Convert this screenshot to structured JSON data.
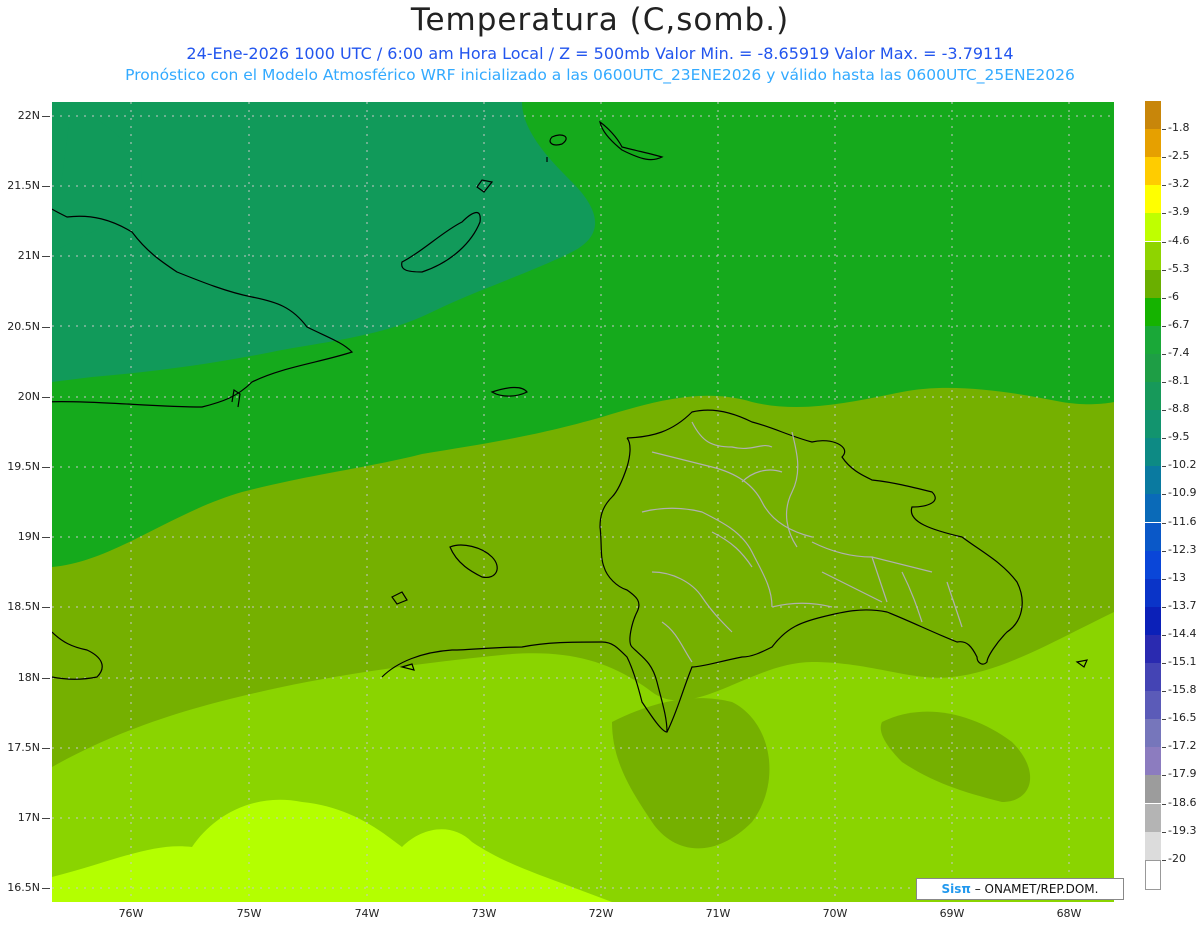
{
  "header": {
    "title": "Temperatura (C,somb.)",
    "subtitle1": "24-Ene-2026  1000 UTC / 6:00 am Hora Local / Z = 500mb  Valor Min. = -8.65919  Valor Max. = -3.79114",
    "subtitle2": "Pronóstico con el Modelo Atmosférico WRF inicializado a las 0600UTC_23ENE2026 y válido hasta las  0600UTC_25ENE2026"
  },
  "axes": {
    "lat_labels": [
      "22N",
      "21.5N",
      "21N",
      "20.5N",
      "20N",
      "19.5N",
      "19N",
      "18.5N",
      "18N",
      "17.5N",
      "17N",
      "16.5N"
    ],
    "lon_labels": [
      "76W",
      "75W",
      "74W",
      "73W",
      "72W",
      "71W",
      "70W",
      "69W",
      "68W"
    ]
  },
  "colorbar": {
    "labels": [
      "-1.8",
      "-2.5",
      "-3.2",
      "-3.9",
      "-4.6",
      "-5.3",
      "-6",
      "-6.7",
      "-7.4",
      "-8.1",
      "-8.8",
      "-9.5",
      "-10.2",
      "-10.9",
      "-11.6",
      "-12.3",
      "-13",
      "-13.7",
      "-14.4",
      "-15.1",
      "-15.8",
      "-16.5",
      "-17.2",
      "-17.9",
      "-18.6",
      "-19.3",
      "-20"
    ],
    "colors": [
      "#c8860a",
      "#e6a000",
      "#ffcc00",
      "#ffff00",
      "#bfff00",
      "#8fd400",
      "#6aaf00",
      "#15b300",
      "#1aa838",
      "#1e9e45",
      "#17995a",
      "#12946e",
      "#0d8a84",
      "#0a7aa0",
      "#0a6ab8",
      "#0a58c8",
      "#0a46d8",
      "#0a34c8",
      "#0b20b8",
      "#2a2ab0",
      "#4444b4",
      "#5b5bb8",
      "#7676bb",
      "#8c7cbf",
      "#9c9c9c",
      "#b4b4b4",
      "#dcdcdc",
      "#ffffff"
    ]
  },
  "map_colors": {
    "dark": "#119a5a",
    "green": "#15aa1c",
    "mid": "#75b000",
    "light": "#8ad400",
    "yellowgreen": "#b4ff00"
  },
  "credit": {
    "logo": "Sisπ",
    "text": " – ONAMET/REP.DOM."
  }
}
